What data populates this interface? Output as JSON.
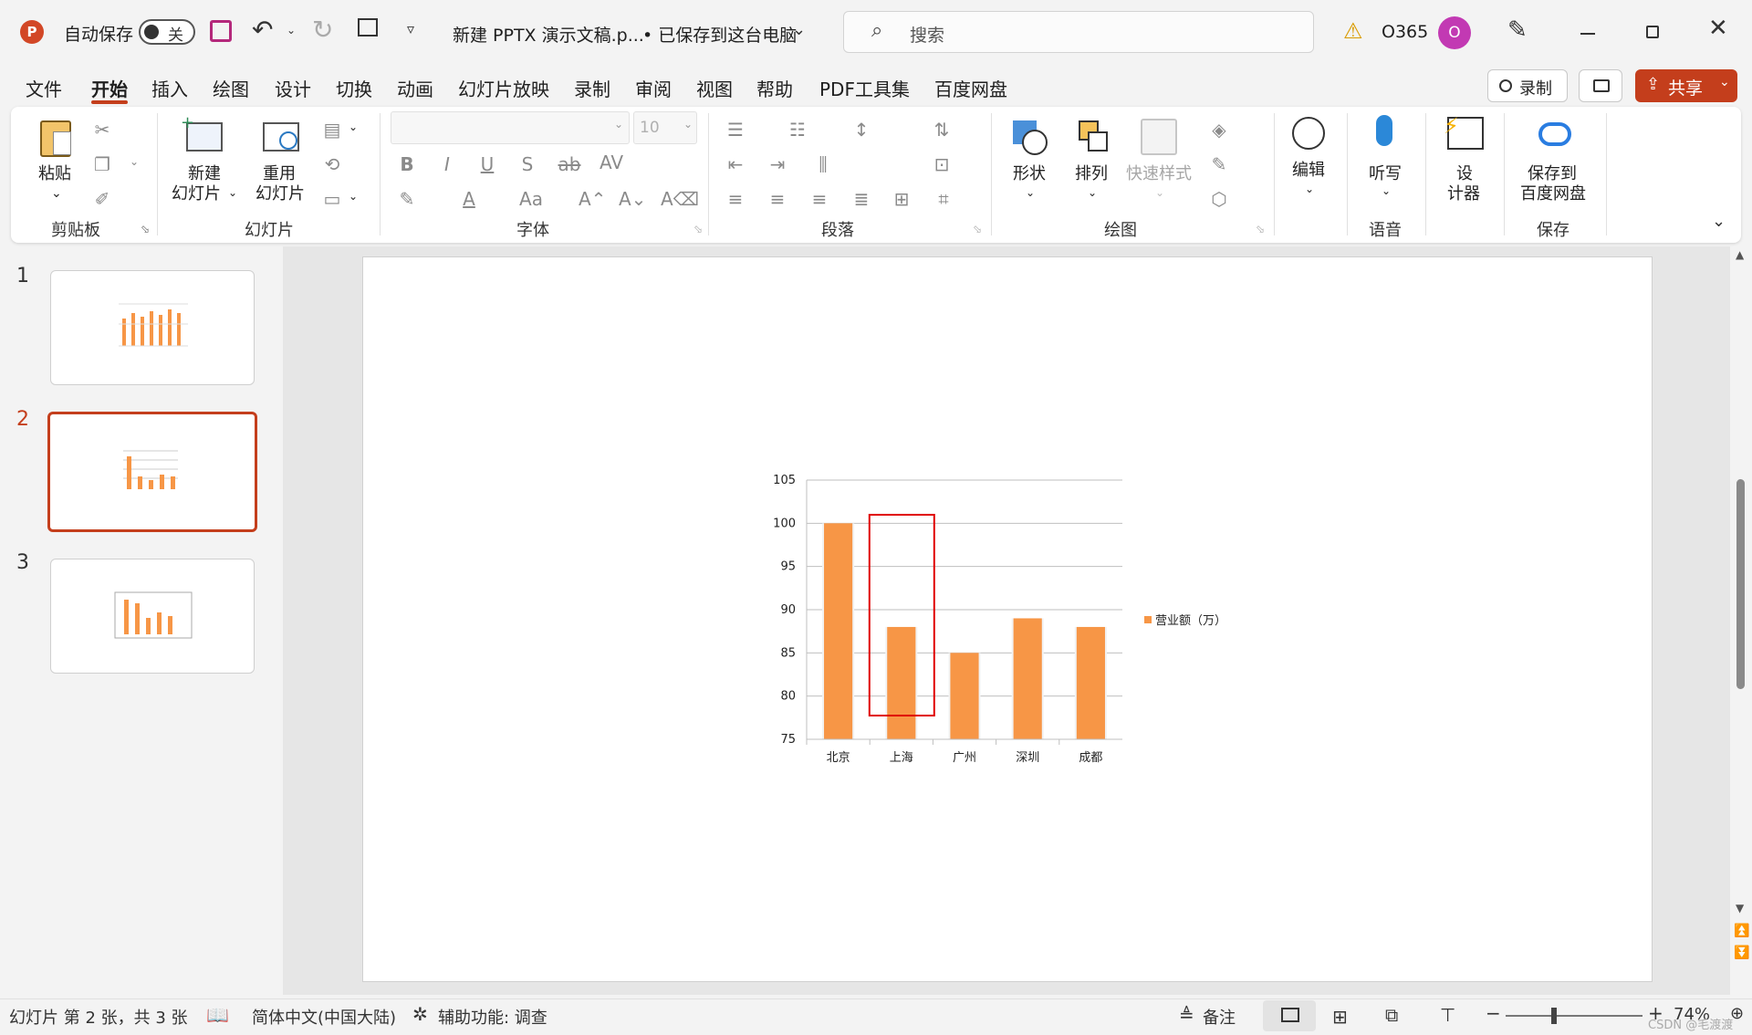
{
  "titlebar": {
    "autosave_label": "自动保存",
    "autosave_state": "关",
    "doc_title": "新建 PPTX 演示文稿.p...",
    "save_status": "• 已保存到这台电脑",
    "search_placeholder": "搜索",
    "account_label": "O365",
    "avatar_initial": "O"
  },
  "menu_tabs": [
    "文件",
    "开始",
    "插入",
    "绘图",
    "设计",
    "切换",
    "动画",
    "幻灯片放映",
    "录制",
    "审阅",
    "视图",
    "帮助",
    "PDF工具集",
    "百度网盘"
  ],
  "active_tab": "开始",
  "actions": {
    "record_label": "录制",
    "share_label": "共享"
  },
  "ribbon": {
    "clipboard": {
      "paste": "粘贴",
      "group": "剪贴板"
    },
    "slides": {
      "new_slide_1": "新建",
      "new_slide_2": "幻灯片",
      "reuse_1": "重用",
      "reuse_2": "幻灯片",
      "group": "幻灯片"
    },
    "font": {
      "size": "10",
      "group": "字体"
    },
    "paragraph": {
      "group": "段落"
    },
    "drawing": {
      "shape": "形状",
      "arrange": "排列",
      "quick_styles": "快速样式",
      "group": "绘图"
    },
    "editing": {
      "edit": "编辑"
    },
    "voice": {
      "dictate": "听写",
      "group": "语音"
    },
    "designer": {
      "line1": "设",
      "line2": "计器"
    },
    "save": {
      "line1": "保存到",
      "line2": "百度网盘",
      "group": "保存"
    }
  },
  "slides_pane": {
    "numbers": [
      "1",
      "2",
      "3"
    ],
    "active": 2
  },
  "chart_data": {
    "type": "bar",
    "categories": [
      "北京",
      "上海",
      "广州",
      "深圳",
      "成都"
    ],
    "series": [
      {
        "name": "营业额（万）",
        "values": [
          100,
          88,
          85,
          89,
          88
        ],
        "color": "#f79646"
      }
    ],
    "ylim": [
      75,
      105
    ],
    "yticks": [
      75,
      80,
      85,
      90,
      95,
      100,
      105
    ],
    "grid": true,
    "legend_position": "right",
    "highlighted_category": "上海",
    "highlight_color": "#e00000"
  },
  "statusbar": {
    "slide_info": "幻灯片 第 2 张，共 3 张",
    "language": "简体中文(中国大陆)",
    "accessibility": "辅助功能: 调查",
    "notes": "备注",
    "zoom": "74%",
    "watermark": "CSDN @毛渡渡"
  },
  "colors": {
    "accent": "#c43e1c",
    "bar": "#f79646"
  }
}
